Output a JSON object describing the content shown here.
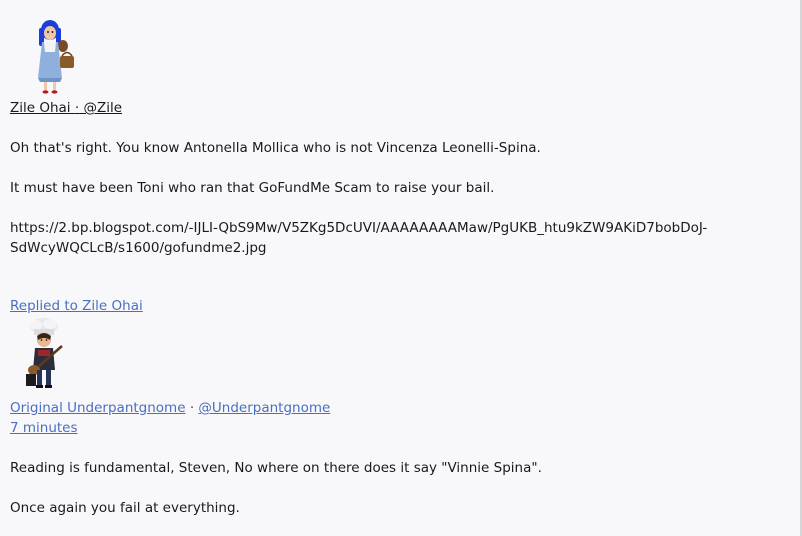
{
  "post1": {
    "avatar_icon": "dorothy-avatar-icon",
    "author_name": "Zile Ohai",
    "separator": "·",
    "author_handle": "@Zile",
    "paragraphs": [
      "Oh that's right. You know Antonella Mollica who is not Vincenza Leonelli-Spina.",
      "It must have been Toni who ran that GoFundMe Scam to raise your bail.",
      "https://2.bp.blogspot.com/-IJLI-QbS9Mw/V5ZKg5DcUVI/AAAAAAAAMaw/PgUKB_htu9kZW9AKiD7bobDoJ-SdWcyWQCLcB/s1600/gofundme2.jpg"
    ]
  },
  "post2": {
    "replied_to": "Replied to Zile Ohai",
    "avatar_icon": "chef-guitar-avatar-icon",
    "author_name": "Original Underpantgnome",
    "separator": "·",
    "author_handle": "@Underpantgnome",
    "timestamp": "7 minutes",
    "paragraphs": [
      "Reading is fundamental, Steven, No where on there does it say \"Vinnie Spina\".",
      "Once again you fail at everything."
    ]
  },
  "colors": {
    "link": "#4a6fbe",
    "text": "#1a1a1a",
    "background": "#f8f8fa"
  }
}
